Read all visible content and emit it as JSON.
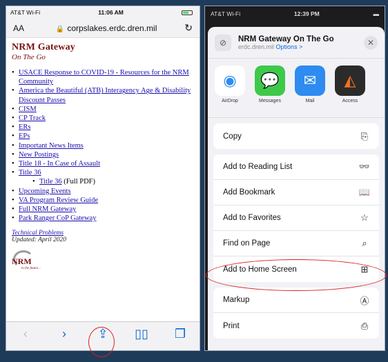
{
  "left": {
    "status": {
      "carrier": "AT&T Wi-Fi",
      "time": "11:06 AM"
    },
    "url_bar": {
      "aa": "AA",
      "address": "corpslakes.erdc.dren.mil"
    },
    "page": {
      "title": "NRM Gateway",
      "subtitle": "On The Go",
      "links": [
        {
          "text": "USACE Response to COVID-19 - Resources for the NRM Community",
          "extra": "",
          "indent": false
        },
        {
          "text": "America the Beautiful (ATB) Interagency Age & Disability Discount Passes",
          "extra": "",
          "indent": false
        },
        {
          "text": "CISM",
          "extra": "",
          "indent": false
        },
        {
          "text": "CP Track",
          "extra": "",
          "indent": false
        },
        {
          "text": "ERs",
          "extra": "",
          "indent": false
        },
        {
          "text": "EPs",
          "extra": "",
          "indent": false
        },
        {
          "text": "Important News Items",
          "extra": "",
          "indent": false
        },
        {
          "text": "New Postings",
          "extra": "",
          "indent": false
        },
        {
          "text": "Title 18 - In Case of Assault",
          "extra": "",
          "indent": false
        },
        {
          "text": "Title 36",
          "extra": "",
          "indent": false
        },
        {
          "text": "Title 36",
          "extra": " (Full PDF)",
          "indent": true
        },
        {
          "text": "Upcoming Events",
          "extra": "",
          "indent": false
        },
        {
          "text": "VA Program Review Guide",
          "extra": "",
          "indent": false
        },
        {
          "text": "Full NRM Gateway",
          "extra": "",
          "indent": false
        },
        {
          "text": "Park Ranger CoP Gateway",
          "extra": "",
          "indent": false
        }
      ],
      "tech_problems": "Technical Problems",
      "updated": "Updated: April 2020",
      "logo_text": "NRM",
      "logo_tagline": "to the future..."
    }
  },
  "right": {
    "status": {
      "carrier": "AT&T Wi-Fi",
      "time": "12:39 PM"
    },
    "sheet": {
      "title": "NRM Gateway On The Go",
      "domain": "erdc.dren.mil",
      "options_label": "Options >",
      "apps": [
        {
          "label": "AirDrop",
          "icon": "airdrop-icon"
        },
        {
          "label": "Messages",
          "icon": "messages-icon"
        },
        {
          "label": "Mail",
          "icon": "mail-icon"
        },
        {
          "label": "Access",
          "icon": "access-icon"
        }
      ],
      "group1": [
        {
          "label": "Copy",
          "icon": "⎘",
          "name": "copy"
        }
      ],
      "group2": [
        {
          "label": "Add to Reading List",
          "icon": "👓",
          "name": "add-to-reading-list"
        },
        {
          "label": "Add Bookmark",
          "icon": "📖",
          "name": "add-bookmark"
        },
        {
          "label": "Add to Favorites",
          "icon": "☆",
          "name": "add-to-favorites"
        },
        {
          "label": "Find on Page",
          "icon": "⌕",
          "name": "find-on-page"
        },
        {
          "label": "Add to Home Screen",
          "icon": "⊞",
          "name": "add-to-home-screen"
        }
      ],
      "group3": [
        {
          "label": "Markup",
          "icon": "Ⓐ",
          "name": "markup"
        },
        {
          "label": "Print",
          "icon": "⎙",
          "name": "print"
        }
      ]
    }
  },
  "colors": {
    "accent": "#0a66d6",
    "highlight": "#d92020",
    "brand": "#7a1212"
  }
}
